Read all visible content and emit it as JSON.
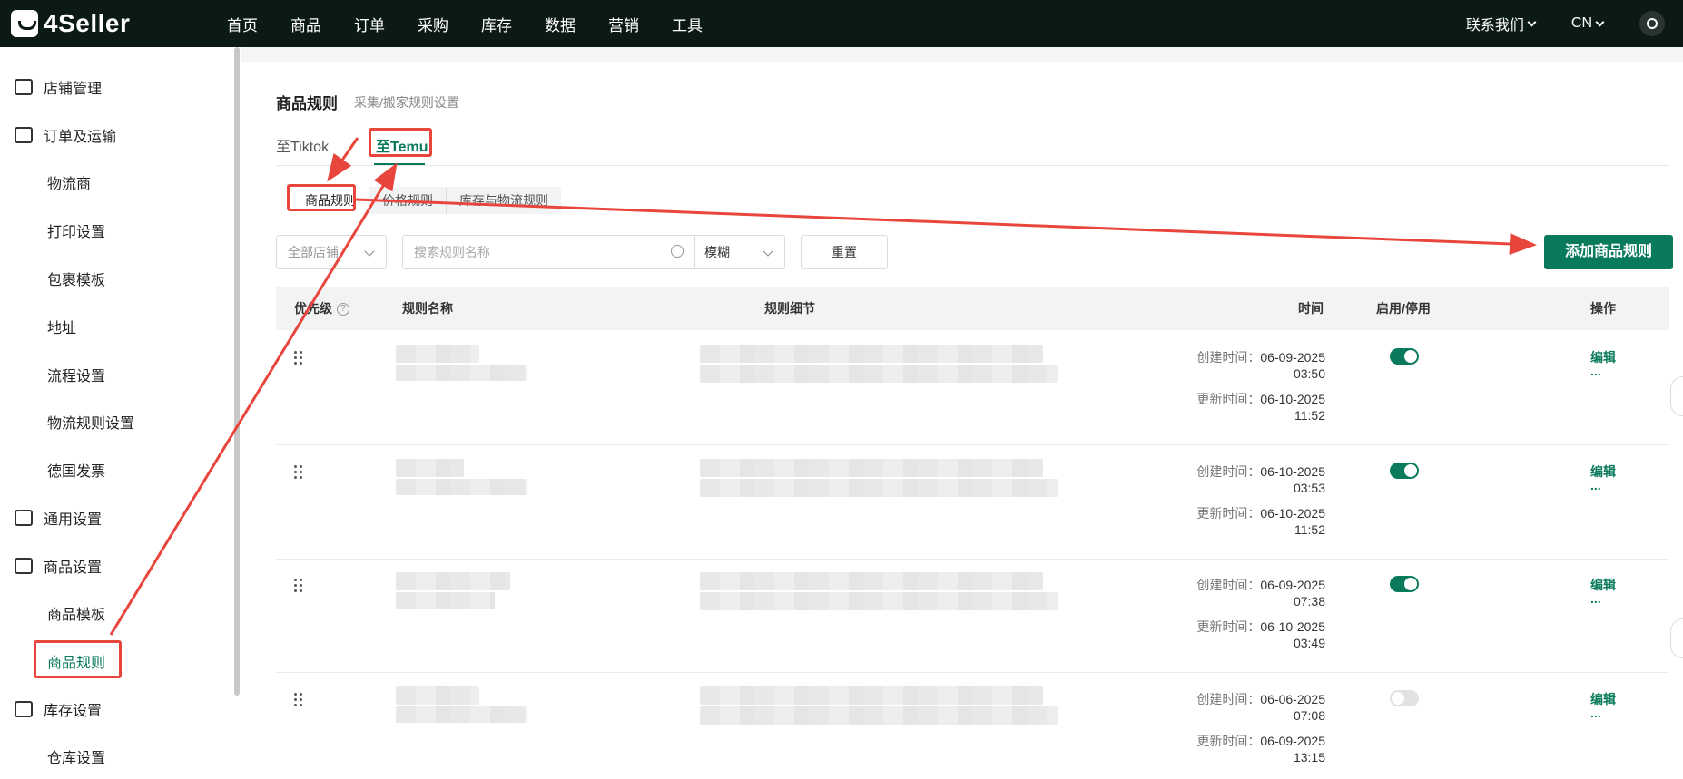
{
  "app": {
    "brand": "4Seller"
  },
  "topnav": {
    "items": [
      "首页",
      "商品",
      "订单",
      "采购",
      "库存",
      "数据",
      "营销",
      "工具"
    ],
    "contact": "联系我们",
    "lang": "CN"
  },
  "sidebar": {
    "store_mgmt": "店铺管理",
    "order_shipping": "订单及运输",
    "logistics": "物流商",
    "print_settings": "打印设置",
    "package_tpl": "包裹模板",
    "address": "地址",
    "flow_settings": "流程设置",
    "logistics_rules": "物流规则设置",
    "de_invoice": "德国发票",
    "general_settings": "通用设置",
    "product_settings": "商品设置",
    "product_tpl": "商品模板",
    "product_rules": "商品规则",
    "inventory_settings": "库存设置",
    "warehouse_settings": "仓库设置"
  },
  "page": {
    "title": "商品规则",
    "subtitle": "采集/搬家规则设置",
    "tabs": [
      "至Tiktok",
      "至Temu"
    ],
    "subtabs": [
      "商品规则",
      "价格规则",
      "库存与物流规则"
    ]
  },
  "filters": {
    "store_placeholder": "全部店铺",
    "search_placeholder": "搜索规则名称",
    "match_mode": "模糊",
    "reset": "重置",
    "add": "添加商品规则"
  },
  "table": {
    "headers": {
      "priority": "优先级",
      "name": "规则名称",
      "detail": "规则细节",
      "time": "时间",
      "enabled": "启用/停用",
      "action": "操作"
    },
    "created_label": "创建时间：",
    "updated_label": "更新时间：",
    "edit": "编辑",
    "more": "...",
    "rows": [
      {
        "created_date": "06-09-2025",
        "created_time": "03:50",
        "updated_date": "06-10-2025",
        "updated_time": "11:52",
        "enabled": true
      },
      {
        "created_date": "06-10-2025",
        "created_time": "03:53",
        "updated_date": "06-10-2025",
        "updated_time": "11:52",
        "enabled": true
      },
      {
        "created_date": "06-09-2025",
        "created_time": "07:38",
        "updated_date": "06-10-2025",
        "updated_time": "03:49",
        "enabled": true
      },
      {
        "created_date": "06-06-2025",
        "created_time": "07:08",
        "updated_date": "06-09-2025",
        "updated_time": "13:15",
        "enabled": false
      }
    ]
  },
  "colors": {
    "brand": "#0a7a5c",
    "topbar": "#0b1a17",
    "annotation": "#e8453c"
  }
}
